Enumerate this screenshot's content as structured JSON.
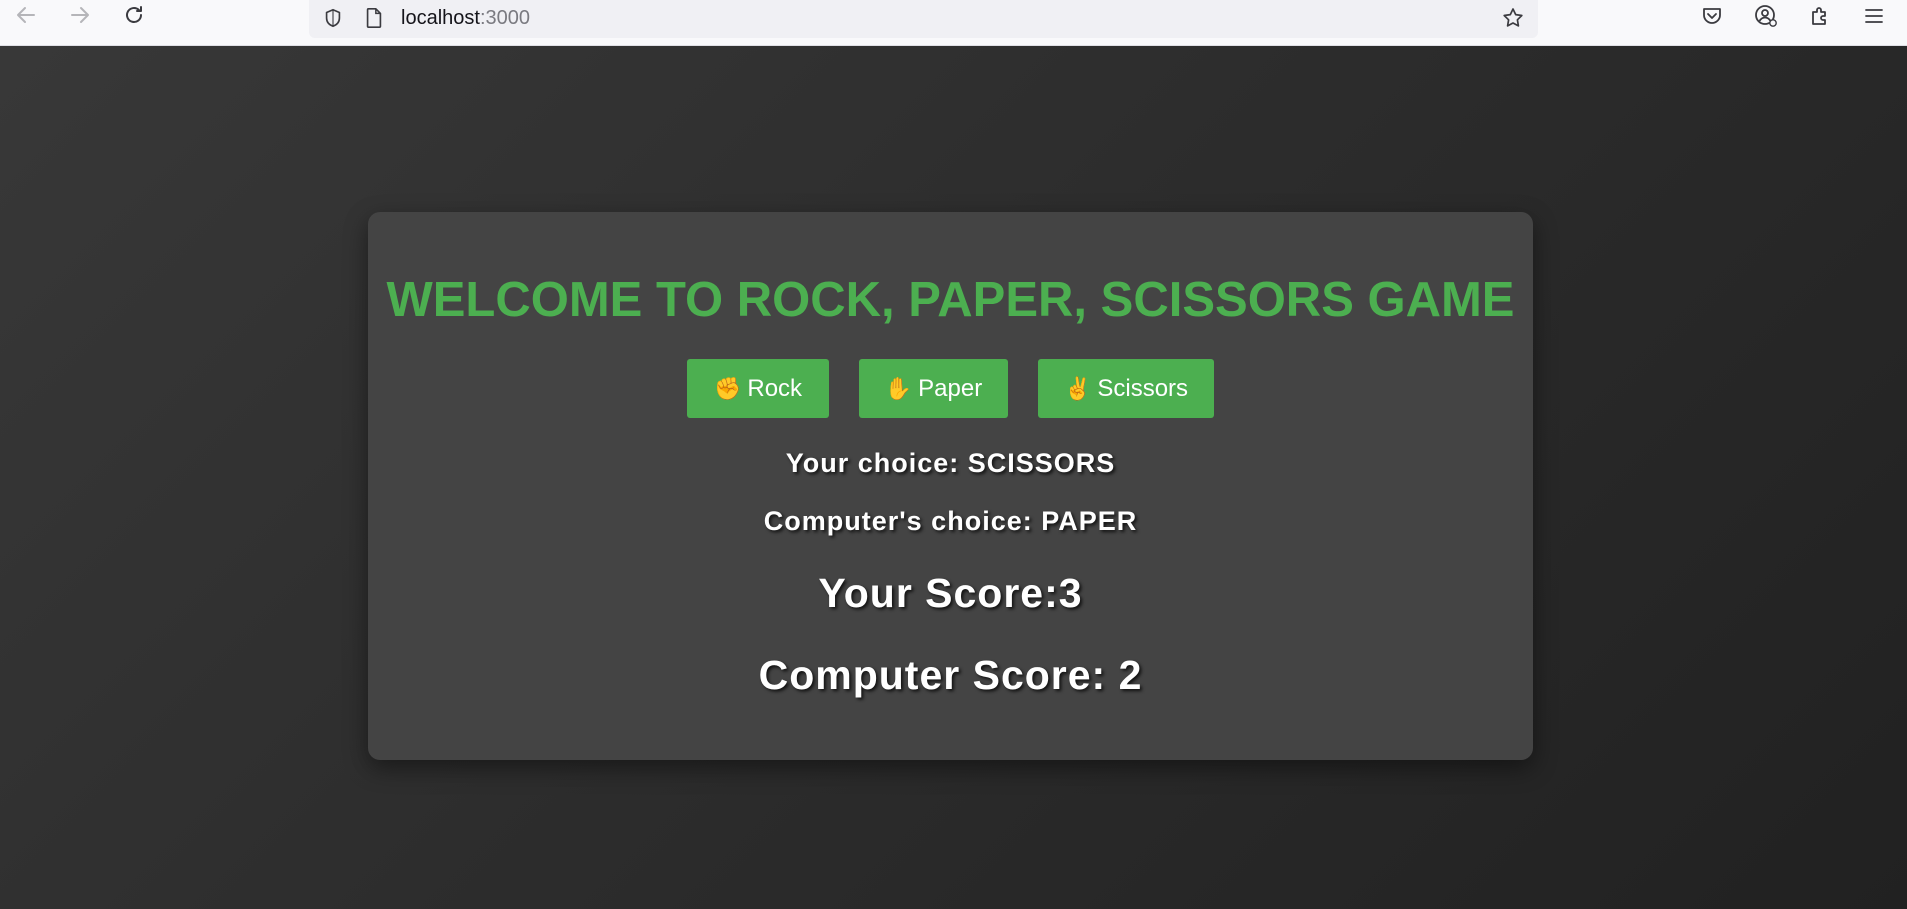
{
  "browser": {
    "url_host": "localhost",
    "url_port": ":3000"
  },
  "game": {
    "title": "WELCOME TO ROCK, PAPER, SCISSORS GAME",
    "buttons": {
      "rock": "Rock",
      "paper": "Paper",
      "scissors": "Scissors"
    },
    "your_choice": "Your choice: SCISSORS",
    "computer_choice": "Computer's choice: PAPER",
    "your_score": "Your Score:3",
    "computer_score": "Computer Score: 2"
  },
  "colors": {
    "accent": "#4caf50",
    "card": "#444444",
    "background": "#2b2b2b",
    "text": "#ffffff"
  },
  "icons": {
    "rock": "fist-icon",
    "paper": "hand-icon",
    "scissors": "scissors-hand-icon"
  }
}
